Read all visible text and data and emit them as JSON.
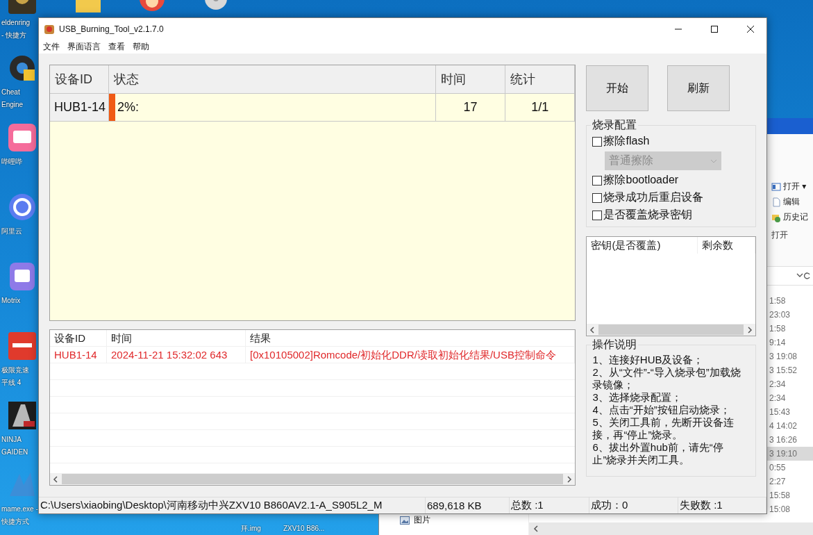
{
  "desktop": {
    "top_icons": [
      {
        "kind": "folder"
      },
      {
        "kind": "mascot"
      },
      {
        "kind": "disc"
      }
    ],
    "icons": [
      {
        "kind": "game",
        "labels": [
          "eldenring",
          "- 快捷方"
        ]
      },
      {
        "kind": "gear",
        "labels": [
          "Cheat",
          "Engine"
        ]
      },
      {
        "kind": "bili",
        "labels": [
          "哔哩哔"
        ]
      },
      {
        "kind": "cloud",
        "labels": [
          "阿里云"
        ]
      },
      {
        "kind": "motrix",
        "labels": [
          "Motrix"
        ]
      },
      {
        "kind": "racing",
        "labels": [
          "极限竞速",
          "平线 4"
        ]
      },
      {
        "kind": "ninja",
        "labels": [
          "NINJA",
          "GAIDEN"
        ]
      },
      {
        "kind": "mame",
        "labels": [
          "mame.exe -",
          "快捷方式"
        ]
      }
    ],
    "bottom_labels": [
      "拜.img",
      "ZXV10 B86..."
    ]
  },
  "explorer": {
    "ribbon": [
      {
        "kind": "open",
        "label": "打开 ▾"
      },
      {
        "kind": "edit",
        "label": "编辑"
      },
      {
        "kind": "history",
        "label": "历史记"
      }
    ],
    "ribbon_group": "打开",
    "nav": [
      {
        "label": "图片"
      }
    ],
    "rows": [
      {
        "time": "1:58",
        "selected": false
      },
      {
        "time": "23:03",
        "selected": false
      },
      {
        "time": "1:58",
        "selected": false
      },
      {
        "time": "9:14",
        "selected": false
      },
      {
        "time": "3 19:08",
        "selected": false
      },
      {
        "time": "3 15:52",
        "selected": false
      },
      {
        "time": "2:34",
        "selected": false
      },
      {
        "time": "2:34",
        "selected": false
      },
      {
        "time": "15:43",
        "selected": false
      },
      {
        "time": "4 14:02",
        "selected": false
      },
      {
        "time": "3 16:26",
        "selected": false
      },
      {
        "time": "3 19:10",
        "selected": true
      },
      {
        "time": "0:55",
        "selected": false
      },
      {
        "time": "2:27",
        "selected": false
      },
      {
        "time": "15:58",
        "selected": false
      },
      {
        "time": "15:08",
        "selected": false
      }
    ]
  },
  "window": {
    "title": "USB_Burning_Tool_v2.1.7.0",
    "menu": [
      "文件",
      "界面语言",
      "查看",
      "帮助"
    ],
    "device_table": {
      "columns": [
        "设备ID",
        "状态",
        "时间",
        "统计"
      ],
      "rows": [
        {
          "device": "HUB1-14",
          "status": "2%:",
          "level": 0.02,
          "time": "17",
          "count": "1/1"
        }
      ]
    },
    "log_table": {
      "columns": [
        "设备ID",
        "时间",
        "结果"
      ],
      "rows": [
        {
          "device": "HUB1-14",
          "time": "2024-11-21 15:32:02 643",
          "result": "[0x10105002]Romcode/初始化DDR/读取初始化结果/USB控制命令",
          "error": true
        }
      ]
    },
    "buttons": [
      "开始",
      "刷新"
    ],
    "config": {
      "title": "烧录配置",
      "items": [
        {
          "kind": "checkbox",
          "label": "擦除flash",
          "checked": false
        },
        {
          "kind": "select",
          "value": "普通擦除",
          "disabled": true
        },
        {
          "kind": "checkbox",
          "label": "擦除bootloader",
          "checked": false
        },
        {
          "kind": "checkbox",
          "label": "烧录成功后重启设备",
          "checked": false
        },
        {
          "kind": "checkbox",
          "label": "是否覆盖烧录密钥",
          "checked": false
        }
      ]
    },
    "key_list": {
      "columns": [
        "密钥(是否覆盖)",
        "剩余数"
      ]
    },
    "help": {
      "title": "操作说明",
      "lines": [
        "1、连接好HUB及设备；",
        "2、从“文件”-“导入烧录包”加载烧录镜像；",
        "3、选择烧录配置；",
        "4、点击“开始”按钮启动烧录；",
        "5、关闭工具前，先断开设备连接，再“停止”烧录。",
        "6、拔出外置hub前，请先“停止”烧录并关闭工具。"
      ]
    },
    "status_bar": [
      "C:\\Users\\xiaobing\\Desktop\\河南移动中兴ZXV10 B860AV2.1-A_S905L2_M",
      "689,618 KB",
      "总数 :1",
      "成功：0",
      "失败数 :1"
    ]
  }
}
